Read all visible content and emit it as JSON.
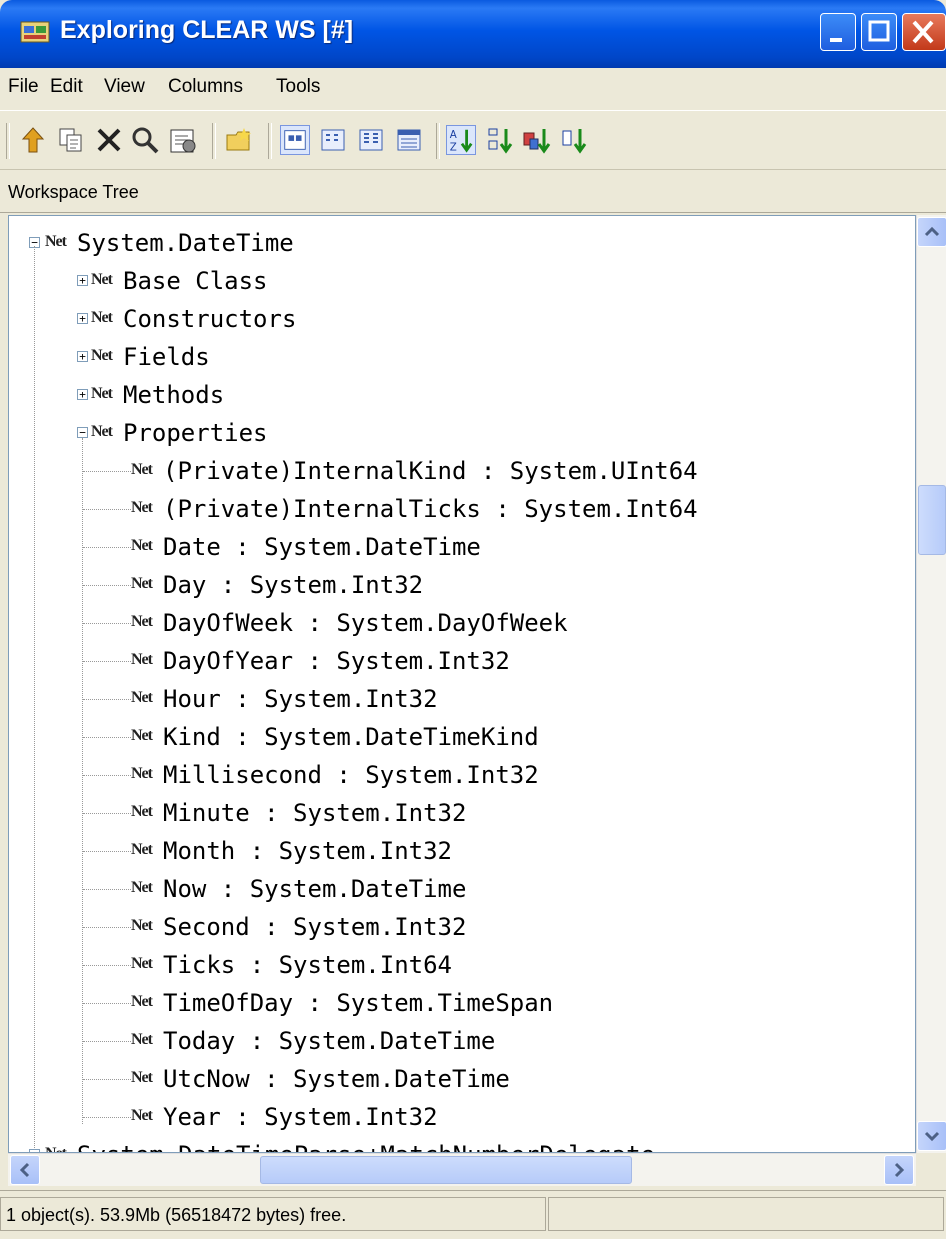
{
  "window": {
    "title": "Exploring CLEAR WS [#]"
  },
  "menu": [
    "File",
    "Edit",
    "View",
    "Columns",
    "Tools"
  ],
  "toolbar": {
    "icons": [
      "up-icon",
      "copy-icon",
      "delete-icon",
      "find-icon",
      "properties-icon",
      "open-folder-icon",
      "large-icons-view-icon",
      "small-icons-view-icon",
      "list-view-icon",
      "details-view-icon",
      "sort-ascending-icon",
      "sort-descending-icon",
      "sort-by-type-icon",
      "sort-by-size-icon"
    ]
  },
  "panel": {
    "title": "Workspace Tree"
  },
  "tree": {
    "icon_text": "Net",
    "root": {
      "label": "System.DateTime",
      "expanded": true
    },
    "groups": [
      {
        "label": "Base Class",
        "expanded": false
      },
      {
        "label": "Constructors",
        "expanded": false
      },
      {
        "label": "Fields",
        "expanded": false
      },
      {
        "label": "Methods",
        "expanded": false
      },
      {
        "label": "Properties",
        "expanded": true
      }
    ],
    "properties": [
      "(Private)InternalKind : System.UInt64",
      "(Private)InternalTicks : System.Int64",
      "Date : System.DateTime",
      "Day : System.Int32",
      "DayOfWeek : System.DayOfWeek",
      "DayOfYear : System.Int32",
      "Hour : System.Int32",
      "Kind : System.DateTimeKind",
      "Millisecond : System.Int32",
      "Minute : System.Int32",
      "Month : System.Int32",
      "Now : System.DateTime",
      "Second : System.Int32",
      "Ticks : System.Int64",
      "TimeOfDay : System.TimeSpan",
      "Today : System.DateTime",
      "UtcNow : System.DateTime",
      "Year : System.Int32"
    ],
    "next_root": "System.DateTimeParse+MatchNumberDelegate"
  },
  "status": {
    "text": "1 object(s). 53.9Mb (56518472 bytes) free."
  },
  "colors": {
    "titlebar": "#0055e5",
    "chrome": "#ece9d8",
    "close": "#c2391a"
  }
}
